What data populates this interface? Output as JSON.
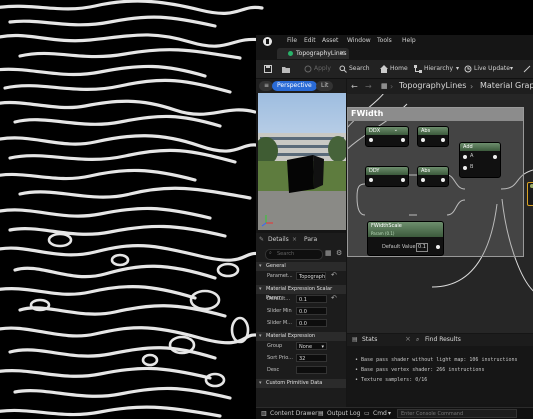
{
  "menu": [
    "File",
    "Edit",
    "Asset",
    "Window",
    "Tools",
    "Help"
  ],
  "tab": {
    "title": "TopographyLines",
    "close": "×"
  },
  "toolbar": {
    "apply": "Apply",
    "search": "Search",
    "home": "Home",
    "hierarchy": "Hierarchy",
    "live_update": "Live Update"
  },
  "viewport": {
    "perspective": "Perspective",
    "lit": "Lit"
  },
  "graph": {
    "breadcrumb_asset": "TopographyLines",
    "breadcrumb_next": "Material Graph",
    "comment_title": "FWidth"
  },
  "nodes": {
    "ddx1": "DDX",
    "abs1": "Abs",
    "add": "Add",
    "ddy": "DDY",
    "abs2": "Abs",
    "add_pin_a": "A",
    "add_pin_b": "B",
    "param_title": "FWidthScale",
    "param_sub": "Param (0.1)",
    "param_pin": "Default Value",
    "param_value": "0.1"
  },
  "details": {
    "tab_details": "Details",
    "tab_params": "Para",
    "search_placeholder": "Search",
    "cat_general": "General",
    "parameter_label": "Paramet...",
    "parameter_value": "Topograph",
    "cat_scalar": "Material Expression Scalar Param",
    "default_label": "Default...",
    "default_value": "0.1",
    "slider_min_label": "Slider Min",
    "slider_min_value": "0.0",
    "slider_max_label": "Slider M...",
    "slider_max_value": "0.0",
    "cat_expression": "Material Expression",
    "group_label": "Group",
    "group_value": "None",
    "sort_label": "Sort Prio...",
    "sort_value": "32",
    "desc_label": "Desc",
    "cat_custom": "Custom Primitive Data"
  },
  "stats": {
    "tab_stats": "Stats",
    "tab_find": "Find Results",
    "lines": [
      "Base pass shader without light map: 106 instructions",
      "Base pass vertex shader: 266 instructions",
      "Texture samplers: 0/16"
    ]
  },
  "bottom": {
    "content_drawer": "Content Drawer",
    "output_log": "Output Log",
    "cmd": "Cmd",
    "console_placeholder": "Enter Console Command"
  },
  "colors": {
    "node_header": "#4e6e4e",
    "graph_bg": "#262626",
    "comment_bg": "#7d7d7d",
    "accent": "#29b36a"
  }
}
